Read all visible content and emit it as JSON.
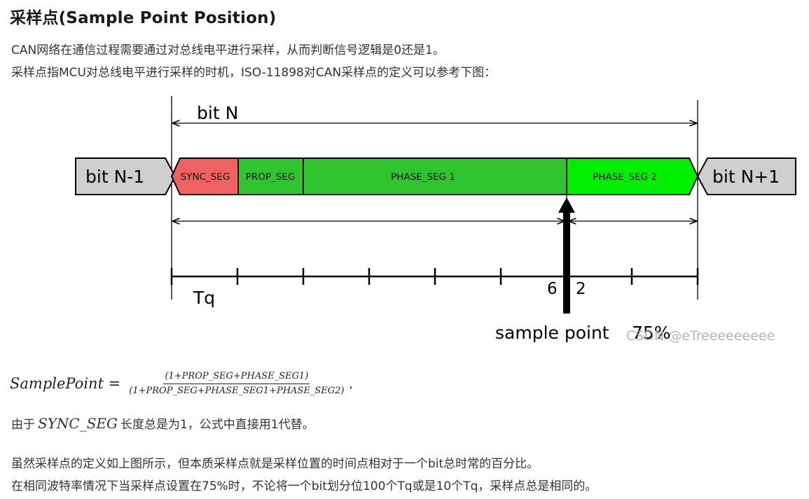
{
  "heading": "采样点(Sample Point Position)",
  "intro_lines": [
    "CAN网络在通信过程需要通过对总线电平进行采样，从而判断信号逻辑是0还是1。",
    "采样点指MCU对总线电平进行采样的时机，ISO-11898对CAN采样点的定义可以参考下图："
  ],
  "diagram": {
    "bit_n_label": "bit N",
    "prev_bit_label": "bit N-1",
    "next_bit_label": "bit N+1",
    "segments": [
      {
        "label": "SYNC_SEG",
        "color": "#f06262"
      },
      {
        "label": "PROP_SEG",
        "color": "#2ec52e"
      },
      {
        "label": "PHASE_SEG 1",
        "color": "#2ec52e"
      },
      {
        "label": "PHASE_SEG 2",
        "color": "#00ee00"
      }
    ],
    "tq_label": "Tq",
    "tq_count_before": "6",
    "tq_count_after": "2",
    "sample_point_label": "sample point",
    "sample_point_percent": "75%",
    "watermark": "CSDN @eTreeeeeeeee"
  },
  "formula": {
    "lhs": "SamplePoint =",
    "numerator": "(1+PROP_SEG+PHASE_SEG1)",
    "denominator": "(1+PROP_SEG+PHASE_SEG1+PHASE_SEG2)",
    "trailing": ","
  },
  "note": {
    "prefix": "由于",
    "math": "SYNC_SEG",
    "suffix": "长度总是为1，公式中直接用1代替。"
  },
  "closing_lines": [
    "虽然采样点的定义如上图所示，但本质采样点就是采样位置的时间点相对于一个bit总时常的百分比。",
    "在相同波特率情况下当采样点设置在75%时，不论将一个bit划分位100个Tq或是10个Tq，采样点总是相同的。"
  ]
}
